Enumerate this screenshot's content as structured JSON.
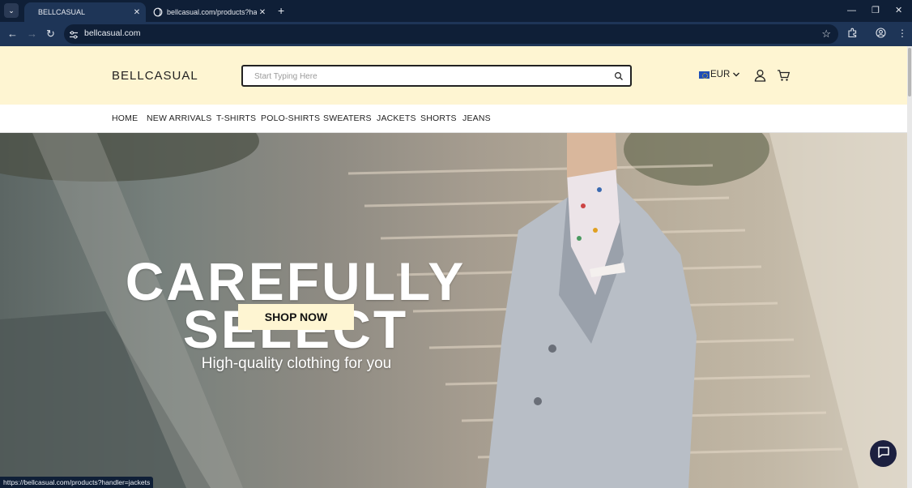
{
  "browser": {
    "tabs": [
      {
        "title": "BELLCASUAL",
        "active": true
      },
      {
        "title": "bellcasual.com/products?handle",
        "active": false
      }
    ],
    "address": "bellcasual.com",
    "status_url": "https://bellcasual.com/products?handler=jackets",
    "glyphs": {
      "tab_menu": "⌄",
      "close": "✕",
      "new_tab": "+",
      "back": "←",
      "forward": "→",
      "reload": "↻",
      "star": "☆",
      "minimize": "—",
      "restore": "❐",
      "window_close": "✕",
      "menu": "⋮"
    }
  },
  "site": {
    "logo": "BELLCASUAL",
    "search_placeholder": "Start Typing Here",
    "currency": "EUR",
    "nav": [
      "HOME",
      "NEW ARRIVALS",
      "T-SHIRTS",
      "POLO-SHIRTS",
      "SWEATERS",
      "JACKETS",
      "SHORTS",
      "JEANS"
    ],
    "header_bg": "#fef5d2"
  },
  "hero": {
    "line1": "CAREFULLY",
    "line2": "SELECT",
    "subtitle": "High-quality clothing for you",
    "cta": "SHOP NOW"
  }
}
